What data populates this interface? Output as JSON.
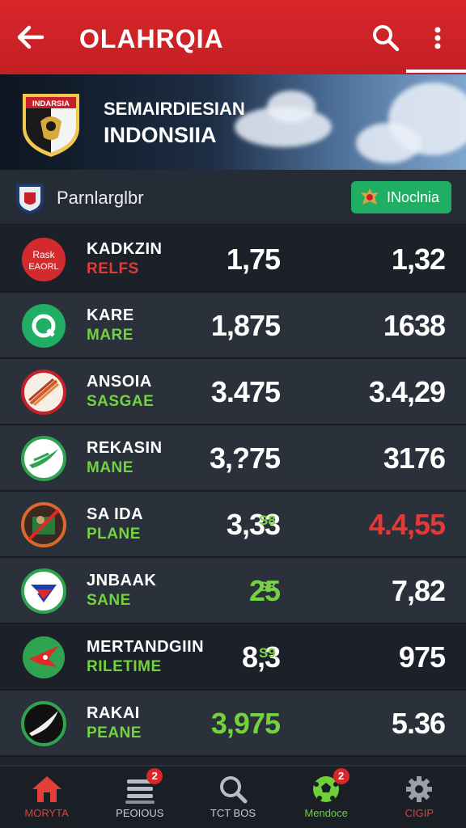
{
  "header": {
    "title": "OLAHRQIA"
  },
  "banner": {
    "line1": "SEMAIRDIESIAN",
    "line2": "INDONSIIA",
    "emblem_text": "INDARSIA"
  },
  "filter": {
    "label": "Parnlarglbr",
    "pill": "INoclnia"
  },
  "rows": [
    {
      "logo_text": [
        "Rask",
        "EAORL"
      ],
      "name": "KADKZIN",
      "sub": "RELFS",
      "sub_color": "red",
      "odd1": "1,75",
      "odd1_color": "white",
      "small": "",
      "odd2": "1,32",
      "odd2_color": "white",
      "dark": true
    },
    {
      "logo_text": [
        "Q",
        ""
      ],
      "name": "KARE",
      "sub": "MARE",
      "sub_color": "green",
      "odd1": "1,875",
      "odd1_color": "white",
      "small": "",
      "odd2": "1638",
      "odd2_color": "white",
      "dark": false
    },
    {
      "logo_text": [
        "",
        ""
      ],
      "name": "ANSOIA",
      "sub": "SASGAE",
      "sub_color": "green",
      "odd1": "3.475",
      "odd1_color": "white",
      "small": "",
      "odd2": "3.4,29",
      "odd2_color": "white",
      "dark": false
    },
    {
      "logo_text": [
        "",
        ""
      ],
      "name": "REKASIN",
      "sub": "MANE",
      "sub_color": "green",
      "odd1": "3,?75",
      "odd1_color": "white",
      "small": "",
      "odd2": "3176",
      "odd2_color": "white",
      "dark": false
    },
    {
      "logo_text": [
        "",
        ""
      ],
      "name": "SA IDA",
      "sub": "PLANE",
      "sub_color": "green",
      "odd1": "3,33",
      "odd1_color": "white",
      "small": "S8",
      "odd2": "4.4,55",
      "odd2_color": "red",
      "dark": false
    },
    {
      "logo_text": [
        "",
        ""
      ],
      "name": "JNBAAK",
      "sub": "SANE",
      "sub_color": "green",
      "odd1": "25",
      "odd1_color": "green",
      "small": "S8",
      "odd2": "7,82",
      "odd2_color": "white",
      "dark": false
    },
    {
      "logo_text": [
        "",
        ""
      ],
      "name": "MERTANDGIIN",
      "sub": "RILETIME",
      "sub_color": "green",
      "odd1": "8,3",
      "odd1_color": "white",
      "small": "S9",
      "odd2": "975",
      "odd2_color": "white",
      "dark": true
    },
    {
      "logo_text": [
        "",
        ""
      ],
      "name": "RAKAI",
      "sub": "PEANE",
      "sub_color": "green",
      "odd1": "3,975",
      "odd1_color": "green",
      "small": "",
      "odd2": "5.36",
      "odd2_color": "white",
      "dark": false
    }
  ],
  "nav": [
    {
      "label": "MORYTA",
      "icon": "home-icon",
      "badge": "",
      "color": "red"
    },
    {
      "label": "PEOIOUS",
      "icon": "list-icon",
      "badge": "2",
      "color": ""
    },
    {
      "label": "TCT BOS",
      "icon": "search-icon",
      "badge": "",
      "color": ""
    },
    {
      "label": "Mendoce",
      "icon": "soccer-ball-icon",
      "badge": "2",
      "color": "green"
    },
    {
      "label": "CIGIP",
      "icon": "gear-icon",
      "badge": "",
      "color": "red"
    }
  ]
}
